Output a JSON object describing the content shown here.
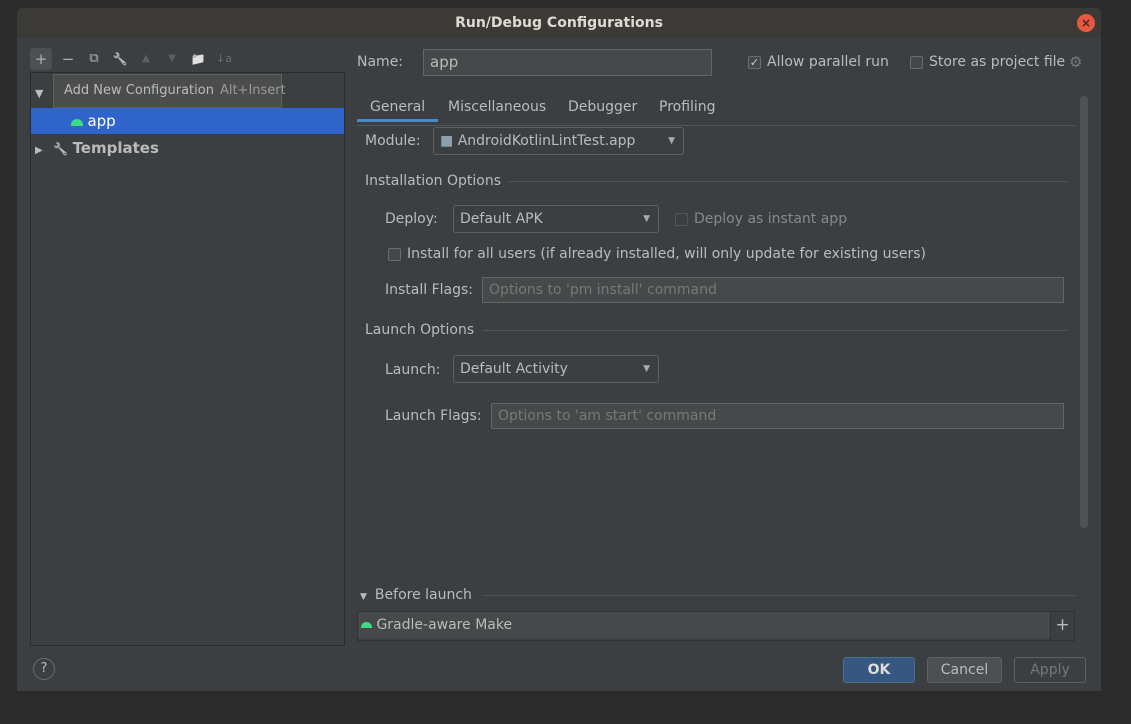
{
  "window": {
    "title": "Run/Debug Configurations"
  },
  "toolbar": {
    "add": "+",
    "remove": "−",
    "copy": "⧉",
    "edit": "🔧",
    "up": "▲",
    "down": "▼",
    "folder": "📁",
    "sort": "↓a"
  },
  "tooltip": {
    "label": "Add New Configuration",
    "shortcut": "Alt+Insert"
  },
  "tree": {
    "items": [
      {
        "label": "app",
        "selected": true,
        "icon": "android-icon"
      },
      {
        "label": "Templates",
        "icon": "wrench-icon"
      }
    ]
  },
  "form": {
    "name_label": "Name:",
    "name_value": "app",
    "allow_parallel": {
      "label": "Allow parallel run",
      "checked": true
    },
    "store_project": {
      "label": "Store as project file",
      "checked": false
    },
    "tabs": [
      {
        "label": "General",
        "active": true
      },
      {
        "label": "Miscellaneous"
      },
      {
        "label": "Debugger"
      },
      {
        "label": "Profiling"
      }
    ],
    "module_label": "Module:",
    "module_value": "AndroidKotlinLintTest.app",
    "installation_title": "Installation Options",
    "deploy_label": "Deploy:",
    "deploy_value": "Default APK",
    "instant_app": {
      "label": "Deploy as instant app",
      "checked": false
    },
    "install_all": {
      "label": "Install for all users (if already installed, will only update for existing users)",
      "checked": false
    },
    "install_flags_label": "Install Flags:",
    "install_flags_placeholder": "Options to 'pm install' command",
    "launch_title": "Launch Options",
    "launch_label": "Launch:",
    "launch_value": "Default Activity",
    "launch_flags_label": "Launch Flags:",
    "launch_flags_placeholder": "Options to 'am start' command",
    "before_launch_title": "Before launch",
    "before_launch_items": [
      "Gradle-aware Make"
    ]
  },
  "buttons": {
    "ok": "OK",
    "cancel": "Cancel",
    "apply": "Apply",
    "help": "?",
    "add_task": "+"
  },
  "colors": {
    "accent": "#2f65ca",
    "ok": "#365880",
    "android": "#3ddc84"
  }
}
